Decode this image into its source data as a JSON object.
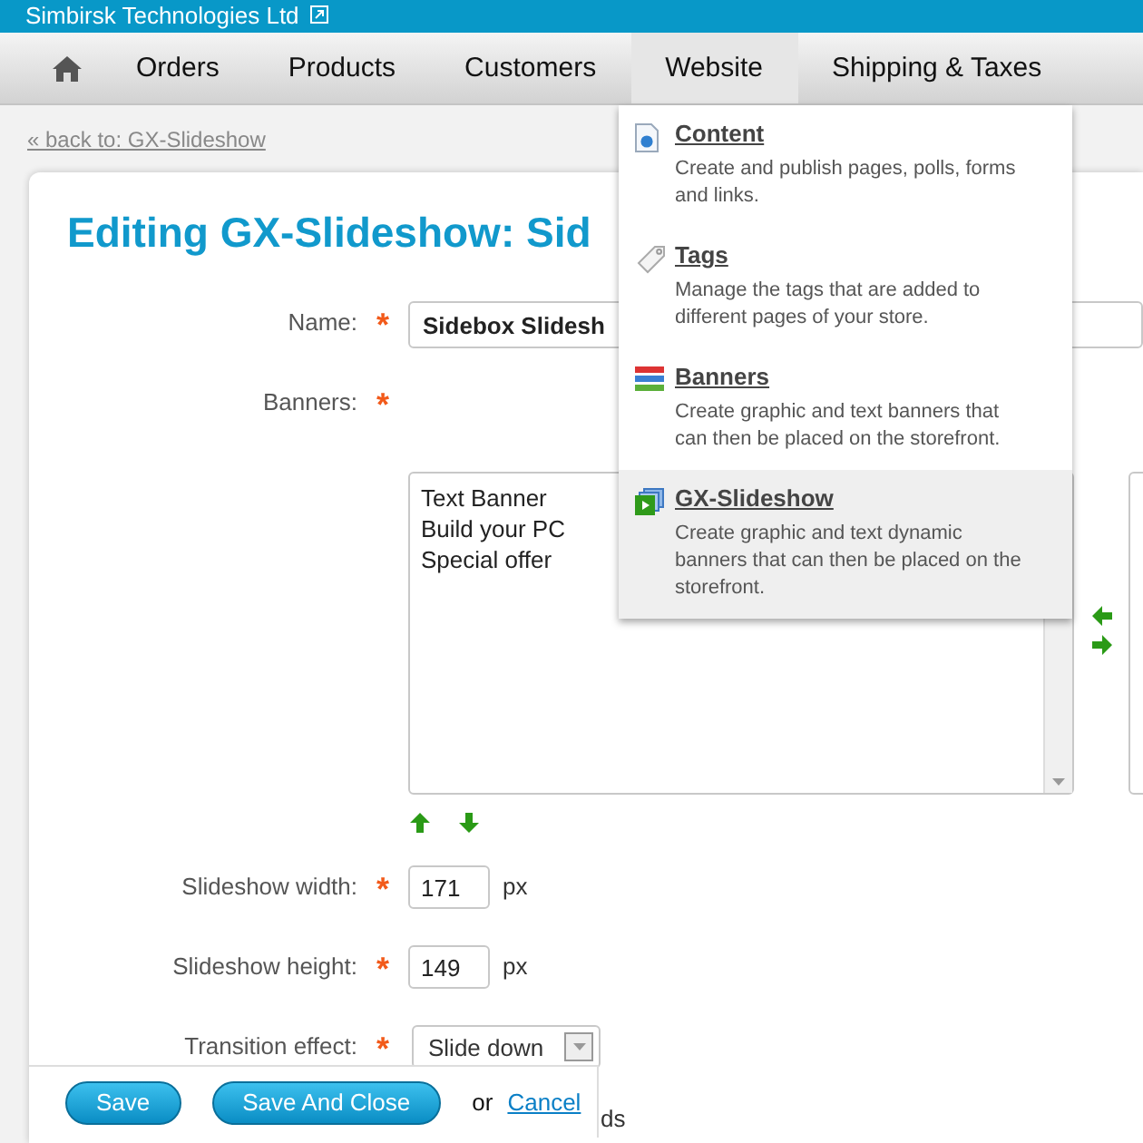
{
  "header": {
    "company": "Simbirsk Technologies Ltd"
  },
  "nav": {
    "items": [
      {
        "label": "Orders",
        "selected": false
      },
      {
        "label": "Products",
        "selected": false
      },
      {
        "label": "Customers",
        "selected": false
      },
      {
        "label": "Website",
        "selected": true
      },
      {
        "label": "Shipping & Taxes",
        "selected": false
      }
    ]
  },
  "menu": {
    "items": [
      {
        "kind": "content",
        "title": "Content",
        "description": "Create and publish pages, polls, forms and links.",
        "selected": false
      },
      {
        "kind": "tags",
        "title": "Tags",
        "description": "Manage the tags that are added to different pages of your store.",
        "selected": false
      },
      {
        "kind": "banners",
        "title": "Banners",
        "description": "Create graphic and text banners that can then be placed on the storefront.",
        "selected": false
      },
      {
        "kind": "slideshow",
        "title": "GX-Slideshow",
        "description": "Create graphic and text dynamic banners that can then be placed on the storefront.",
        "selected": true
      }
    ]
  },
  "back_link": "« back to: GX-Slideshow",
  "title": "Editing GX-Slideshow: Sid",
  "form": {
    "fields": [
      {
        "kind": "text",
        "label": "Name:",
        "marker": "*",
        "value": "Sidebox Slidesh"
      },
      {
        "kind": "listbox",
        "label": "Banners:",
        "marker": "*",
        "options": [
          "Text Banner",
          "Build your PC",
          "Special offer"
        ]
      },
      {
        "kind": "number",
        "label": "Slideshow width:",
        "marker": "*",
        "value": "171",
        "unit": "px"
      },
      {
        "kind": "number",
        "label": "Slideshow height:",
        "marker": "*",
        "value": "149",
        "unit": "px"
      },
      {
        "kind": "select",
        "label": "Transition effect:",
        "marker": "*",
        "value": "Slide down"
      },
      {
        "kind": "hidden",
        "unit": "ds"
      }
    ]
  },
  "actions": {
    "buttons": [
      "Save",
      "Save And Close"
    ],
    "separator": "or",
    "cancel": "Cancel"
  }
}
